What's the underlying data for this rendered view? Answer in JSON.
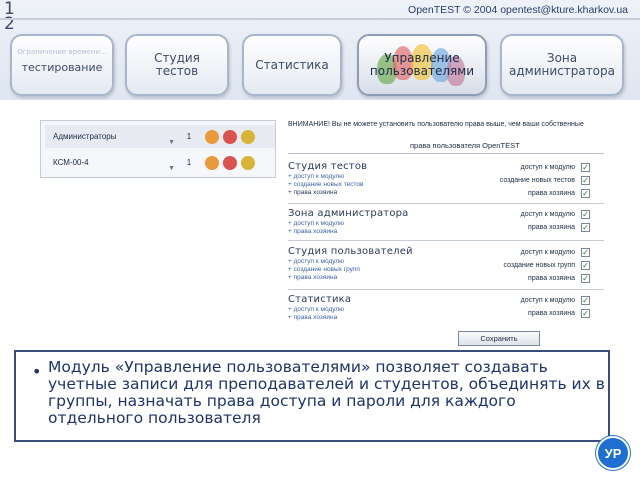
{
  "slide_number": "12",
  "copyright": "OpenTEST  © 2004 opentest@kture.kharkov.ua",
  "nav": [
    {
      "label": "тестирование",
      "ghost": "Ограничение времени..."
    },
    {
      "label": "Студия\nтестов"
    },
    {
      "label": "Статистика"
    },
    {
      "label": "Управление\nпользователями"
    },
    {
      "label": "Зона\nадминистратора"
    }
  ],
  "users": [
    {
      "name": "Администраторы",
      "count": "1"
    },
    {
      "name": "КСМ-00-4",
      "count": "1"
    }
  ],
  "warning": "ВНИМАНИЕ! Вы не можете установить пользователю права выше, чем ваши собственные",
  "rights_header": "права пользователя OpenTEST",
  "sections": [
    {
      "title": "Студия тестов",
      "subs": [
        "+ доступ к модулю",
        "+ создание новых тестов",
        "+  права хозяина"
      ],
      "rights": [
        "доступ к модулю",
        "создание новых тестов",
        "права хозяина"
      ]
    },
    {
      "title": "Зона администратора",
      "subs": [
        "+ доступ к модулю",
        "+ права хозяина"
      ],
      "rights": [
        "доступ к модулю",
        "права хозяина"
      ]
    },
    {
      "title": "Студия пользователей",
      "subs": [
        "+ доступ к модулю",
        "+ создание новых групп",
        "+ права хозяина"
      ],
      "rights": [
        "доступ к модулю",
        "создание новых групп",
        "права хозяина"
      ]
    },
    {
      "title": "Статистика",
      "subs": [
        "+ доступ к модулю",
        "+ права хозяина"
      ],
      "rights": [
        "доступ к модулю",
        "права хозяина"
      ]
    }
  ],
  "save_label": "Сохранить",
  "description": "Модуль «Управление пользователями» позволяет создавать учетные записи для преподавателей и студентов, объединять их в группы, назначать права доступа и пароли для каждого отдельного пользователя",
  "logo_text": "УР",
  "colors": {
    "accent": "#1e3468",
    "check": "#1a7a2a",
    "link": "#3e62a8"
  }
}
